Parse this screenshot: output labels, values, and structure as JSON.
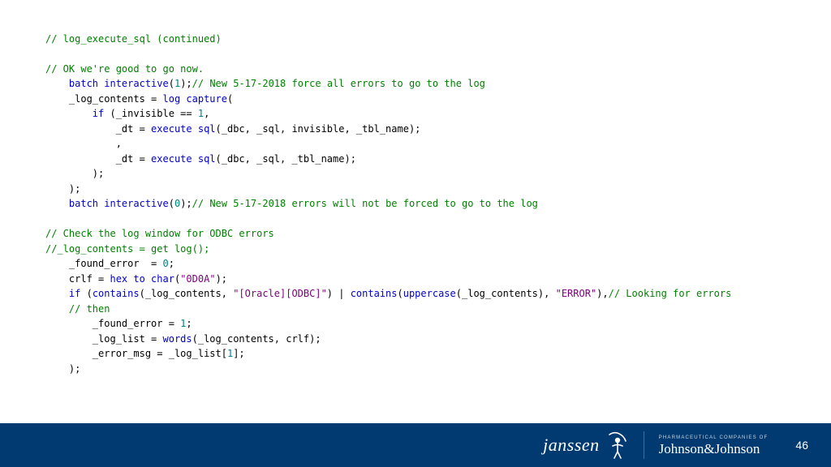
{
  "code": {
    "l1": {
      "a": "// log_execute_sql (continued)"
    },
    "l2": {
      "a": ""
    },
    "l3": {
      "a": "// OK we're good to go now."
    },
    "l4": {
      "a": "    ",
      "b": "batch interactive",
      "c": "(",
      "d": "1",
      "e": ");",
      "f": "// New 5-17-2018 force all errors to go to the log"
    },
    "l5": {
      "a": "    _log_contents = ",
      "b": "log capture",
      "c": "("
    },
    "l6": {
      "a": "        ",
      "b": "if",
      "c": " (_invisible == ",
      "d": "1",
      "e": ","
    },
    "l7": {
      "a": "            _dt = ",
      "b": "execute sql",
      "c": "(_dbc, _sql, invisible, _tbl_name);"
    },
    "l8": {
      "a": "            ,"
    },
    "l9": {
      "a": "            _dt = ",
      "b": "execute sql",
      "c": "(_dbc, _sql, _tbl_name);"
    },
    "l10": {
      "a": "        );"
    },
    "l11": {
      "a": "    );"
    },
    "l12": {
      "a": "    ",
      "b": "batch interactive",
      "c": "(",
      "d": "0",
      "e": ");",
      "f": "// New 5-17-2018 errors will not be forced to go to the log"
    },
    "l13": {
      "a": ""
    },
    "l14": {
      "a": "// Check the log window for ODBC errors"
    },
    "l15": {
      "a": "//_log_contents = get log();"
    },
    "l16": {
      "a": "    _found_error  = ",
      "b": "0",
      "c": ";"
    },
    "l17": {
      "a": "    crlf = ",
      "b": "hex to char",
      "c": "(",
      "d": "\"0D0A\"",
      "e": ");"
    },
    "l18": {
      "a": "    ",
      "b": "if",
      "c": " (",
      "d": "contains",
      "e": "(_log_contents, ",
      "f": "\"[Oracle][ODBC]\"",
      "g": ") | ",
      "h": "contains",
      "i": "(",
      "j": "uppercase",
      "k": "(_log_contents), ",
      "l": "\"ERROR\"",
      "m": "),",
      "n": "// Looking for errors"
    },
    "l19": {
      "a": "    ",
      "b": "// then"
    },
    "l20": {
      "a": "        _found_error = ",
      "b": "1",
      "c": ";"
    },
    "l21": {
      "a": "        _log_list = ",
      "b": "words",
      "c": "(_log_contents, crlf);"
    },
    "l22": {
      "a": "        _error_msg = _log_list[",
      "b": "1",
      "c": "];"
    },
    "l23": {
      "a": "    );"
    }
  },
  "footer": {
    "brand1": "janssen",
    "tagline": "PHARMACEUTICAL COMPANIES OF",
    "brand2": "Johnson&Johnson",
    "page": "46"
  }
}
